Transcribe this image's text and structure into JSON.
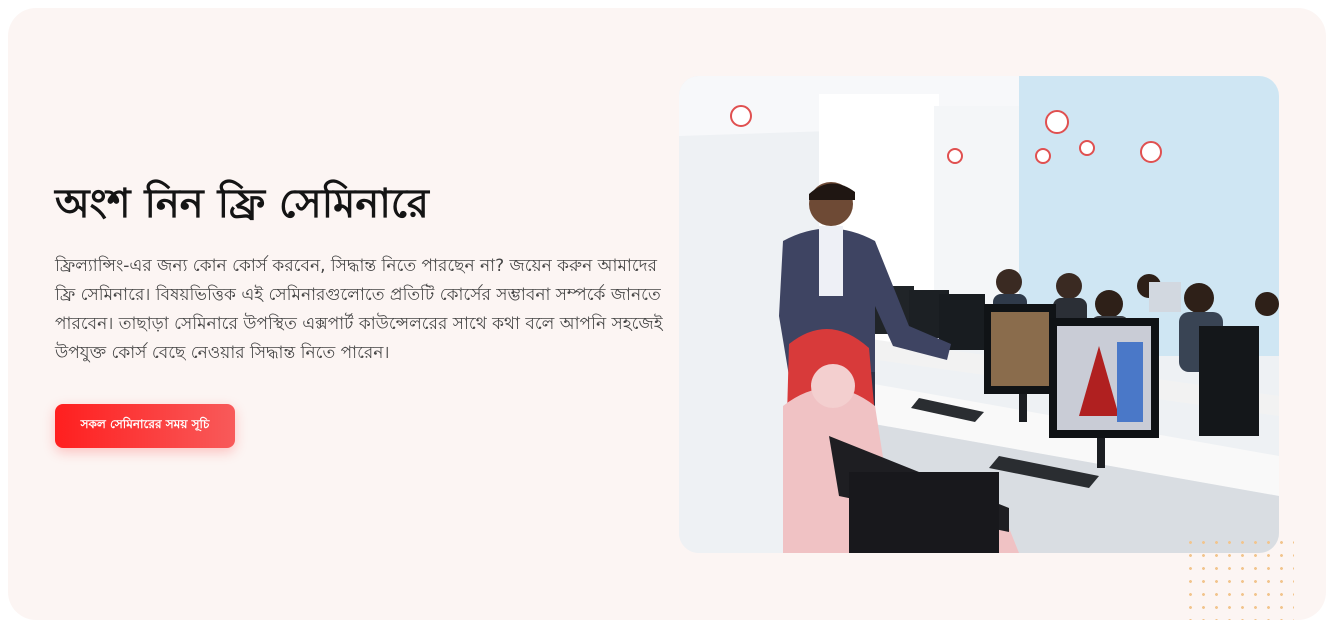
{
  "seminar": {
    "headline": "অংশ নিন ফ্রি সেমিনারে",
    "description": "ফ্রিল্যান্সিং-এর জন্য কোন কোর্স করবেন, সিদ্ধান্ত নিতে পারছেন না? জয়েন করুন আমাদের ফ্রি সেমিনারে। বিষয়ভিত্তিক এই সেমিনারগুলোতে প্রতিটি কোর্সের সম্ভাবনা সম্পর্কে জানতে পারবেন। তাছাড়া সেমিনারে উপস্থিত এক্সপার্ট কাউন্সেলরের সাথে কথা বলে আপনি সহজেই উপযুক্ত কোর্স বেছে নেওয়ার সিদ্ধান্ত নিতে পারেন।",
    "cta_label": "সকল সেমিনারের সময় সূচি"
  },
  "colors": {
    "card_background": "#fcf5f3",
    "accent": "#ff1f1f",
    "heading": "#141414",
    "body_text": "#454545"
  }
}
